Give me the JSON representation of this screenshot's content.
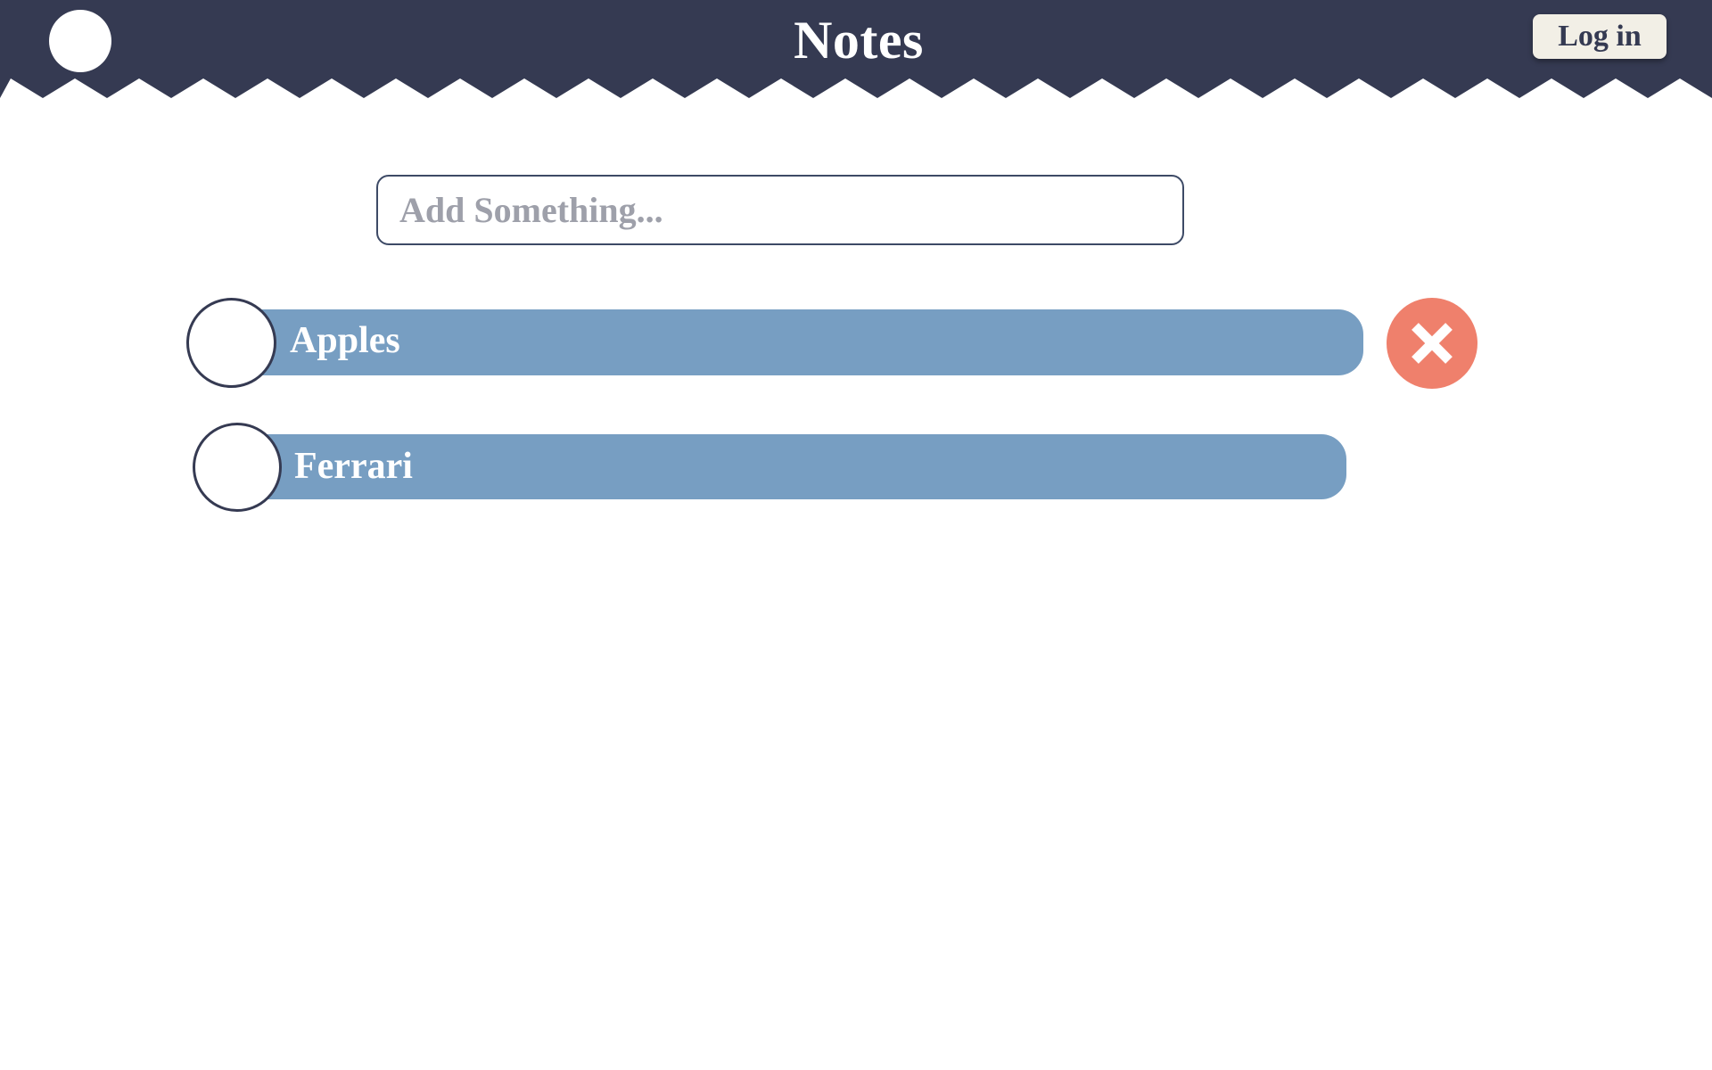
{
  "header": {
    "title": "Notes",
    "login_label": "Log in",
    "background_color": "#353a52"
  },
  "composer": {
    "placeholder": "Add Something...",
    "value": ""
  },
  "notes": [
    {
      "label": "Apples",
      "completed": false,
      "delete_visible": true
    },
    {
      "label": "Ferrari",
      "completed": false,
      "delete_visible": false
    }
  ],
  "colors": {
    "note_bar": "#779ec2",
    "delete_button": "#ef806c",
    "login_button": "#f2efe6",
    "accent_dark": "#353a52"
  },
  "icons": {
    "delete": "close-icon",
    "logo": "circle-logo"
  }
}
